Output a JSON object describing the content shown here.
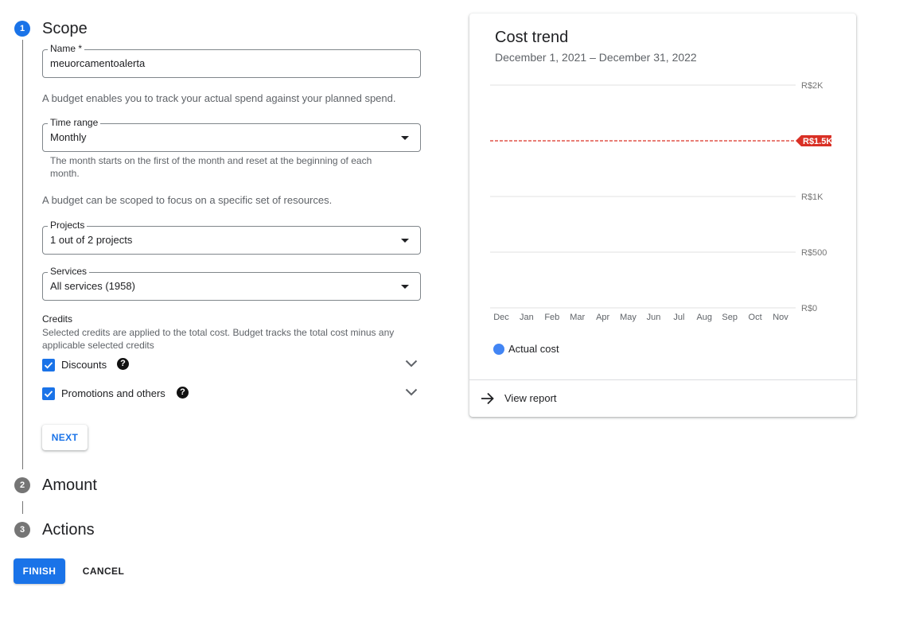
{
  "steps": [
    {
      "number": "1",
      "title": "Scope"
    },
    {
      "number": "2",
      "title": "Amount"
    },
    {
      "number": "3",
      "title": "Actions"
    }
  ],
  "scope": {
    "name_field": {
      "label": "Name *",
      "value": "meuorcamentoalerta"
    },
    "intro_text": "A budget enables you to track your actual spend against your planned spend.",
    "time_range": {
      "label": "Time range",
      "value": "Monthly",
      "helper_line1": "The month starts on the first of the month and reset at the beginning of each",
      "helper_line2": "month."
    },
    "scope_text": "A budget can be scoped to focus on a specific set of resources.",
    "projects": {
      "label": "Projects",
      "value": "1 out of 2 projects"
    },
    "services": {
      "label": "Services",
      "value": "All services (1958)"
    },
    "credits": {
      "title": "Credits",
      "description_line1": "Selected credits are applied to the total cost. Budget tracks the total cost minus any",
      "description_line2": "applicable selected credits",
      "options": [
        {
          "label": "Discounts",
          "checked": true
        },
        {
          "label": "Promotions and others",
          "checked": true
        }
      ]
    },
    "next_label": "NEXT"
  },
  "footer": {
    "finish_label": "FINISH",
    "cancel_label": "CANCEL"
  },
  "card": {
    "title": "Cost trend",
    "subtitle": "December 1, 2021 – December 31, 2022",
    "legend_label": "Actual cost",
    "view_report_label": "View report"
  },
  "chart_data": {
    "type": "line",
    "categories": [
      "Dec",
      "Jan",
      "Feb",
      "Mar",
      "Apr",
      "May",
      "Jun",
      "Jul",
      "Aug",
      "Sep",
      "Oct",
      "Nov"
    ],
    "series": [
      {
        "name": "Actual cost",
        "values": [],
        "color": "#4285f4"
      }
    ],
    "y_ticks": [
      {
        "value": 0,
        "label": "R$0"
      },
      {
        "value": 500,
        "label": "R$500"
      },
      {
        "value": 1000,
        "label": "R$1K"
      },
      {
        "value": 2000,
        "label": "R$2K"
      }
    ],
    "ylim": [
      0,
      2000
    ],
    "budget_line": {
      "value": 1500,
      "label": "R$1.5K",
      "color": "#d93025"
    },
    "grid": true,
    "legend": "bottom-left"
  },
  "colors": {
    "accent": "#1a73e8",
    "budget": "#d93025",
    "series": "#4285f4"
  }
}
